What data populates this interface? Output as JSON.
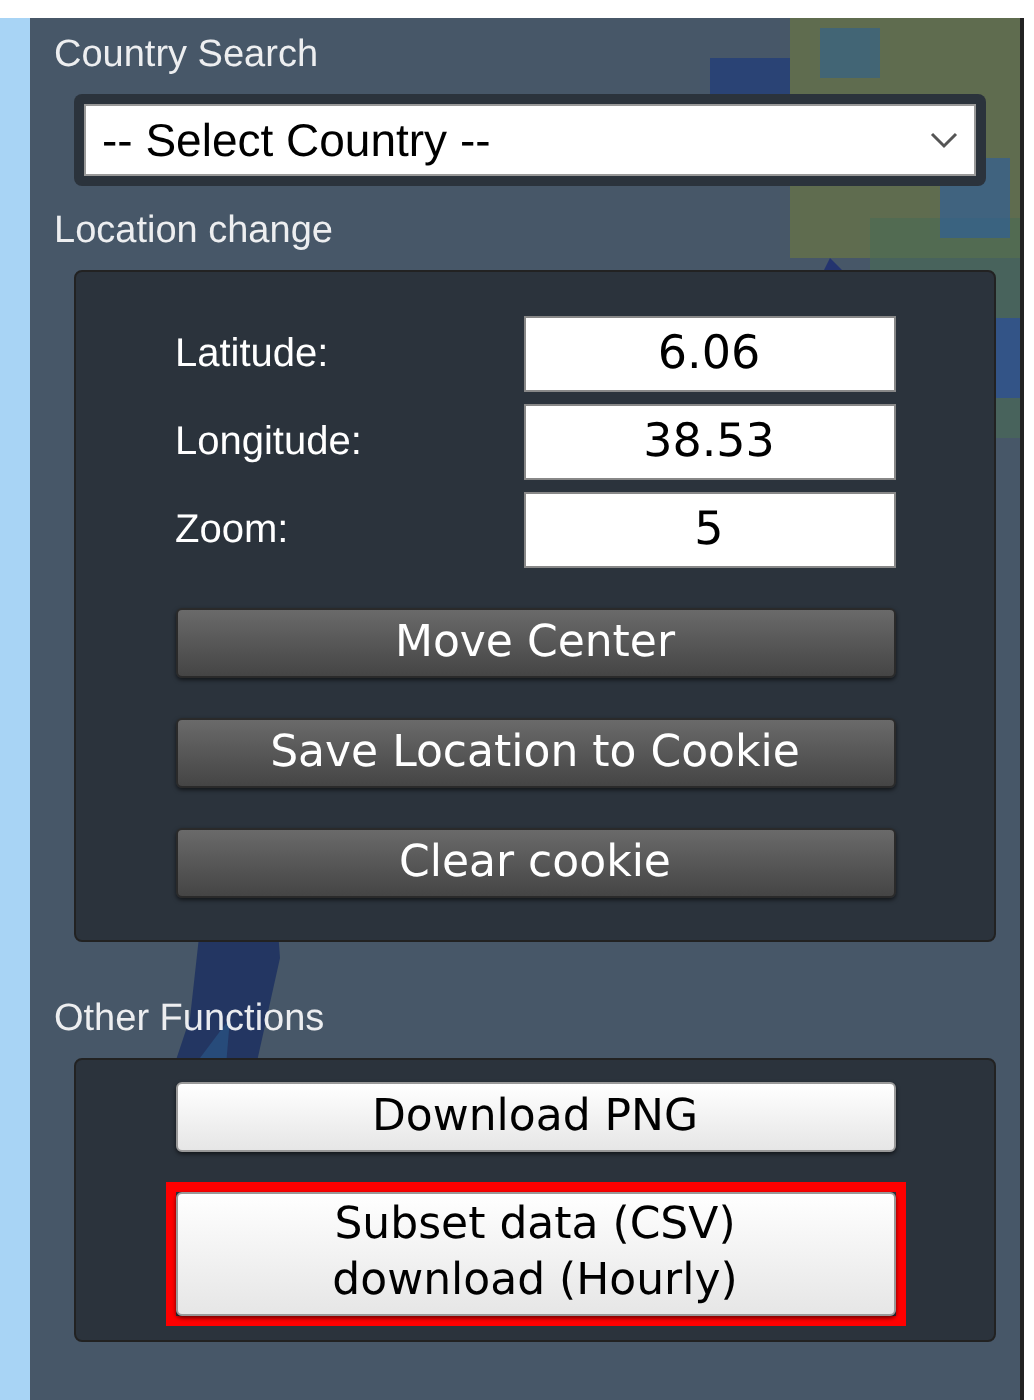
{
  "country_search": {
    "title": "Country Search",
    "select": {
      "value": "-- Select Country --"
    }
  },
  "location_change": {
    "title": "Location change",
    "fields": [
      {
        "label": "Latitude:",
        "value": "6.06"
      },
      {
        "label": "Longitude:",
        "value": "38.53"
      },
      {
        "label": "Zoom:",
        "value": "5"
      }
    ],
    "buttons": [
      {
        "label": "Move Center",
        "kind": "dark",
        "highlighted": false
      },
      {
        "label": "Save Location to Cookie",
        "kind": "dark",
        "highlighted": false
      },
      {
        "label": "Clear cookie",
        "kind": "dark",
        "highlighted": false
      }
    ]
  },
  "other_functions": {
    "title": "Other Functions",
    "buttons": [
      {
        "label": "Download PNG",
        "kind": "light",
        "highlighted": false
      },
      {
        "label": "Subset data (CSV)\ndownload (Hourly)",
        "kind": "light",
        "highlighted": true
      }
    ]
  }
}
